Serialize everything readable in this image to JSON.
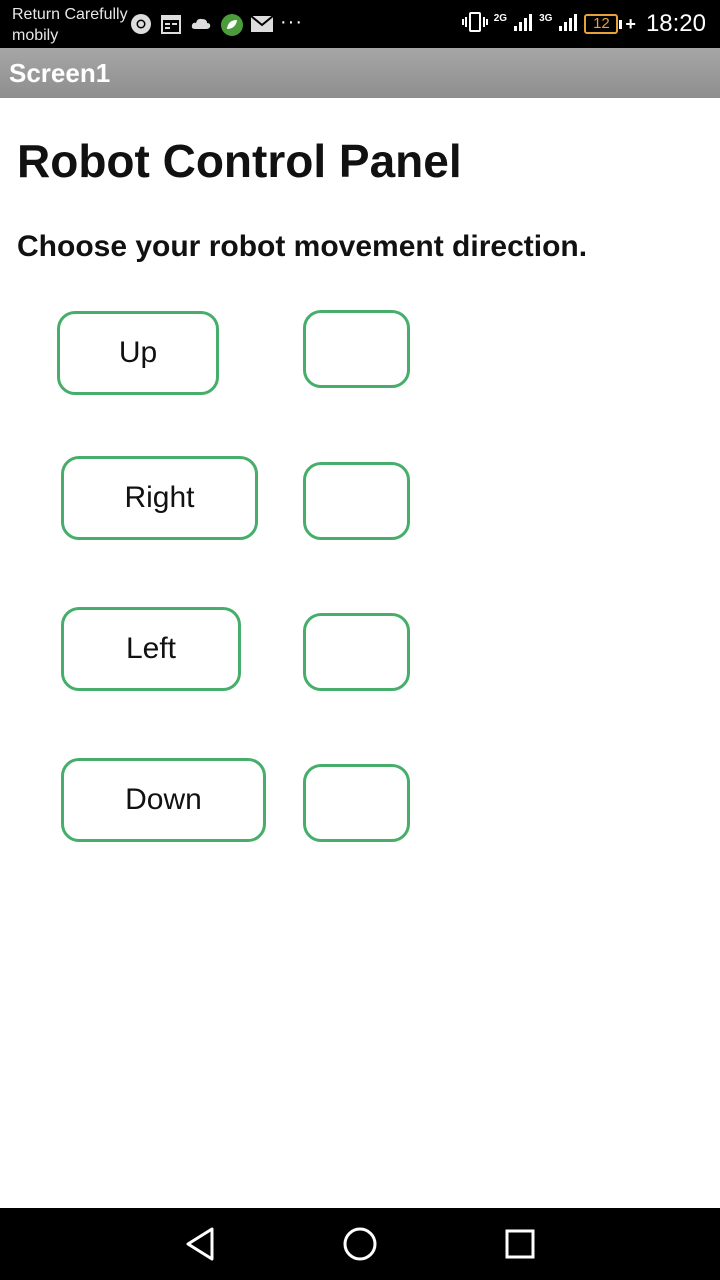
{
  "status_bar": {
    "carrier_line1": "Return Carefully",
    "carrier_line2": "mobily",
    "network_1": "2G",
    "network_2": "3G",
    "battery_level": "12",
    "time": "18:20",
    "left_icons": [
      "chrome-icon",
      "calendar-icon",
      "cloud-icon",
      "app-leaf-icon",
      "mail-icon",
      "more-dots-icon"
    ],
    "right_icons": [
      "vibrate-icon",
      "signal-icon",
      "battery-icon"
    ],
    "overflow_dots": "···"
  },
  "app_bar": {
    "title": "Screen1"
  },
  "main": {
    "heading": "Robot Control Panel",
    "instructions": "Choose your robot movement direction.",
    "controls": [
      {
        "label": "Up",
        "status": ""
      },
      {
        "label": "Right",
        "status": ""
      },
      {
        "label": "Left",
        "status": ""
      },
      {
        "label": "Down",
        "status": ""
      }
    ]
  },
  "colors": {
    "button_border": "#46ae6a",
    "title_bar": "#999999",
    "status_bar": "#000000",
    "battery_warning": "#e8a13a"
  },
  "nav_bar": {
    "icons": [
      "back-icon",
      "home-icon",
      "recents-icon"
    ]
  }
}
